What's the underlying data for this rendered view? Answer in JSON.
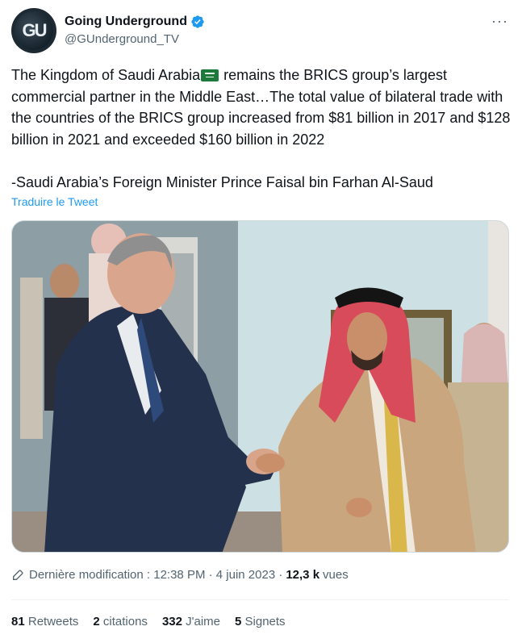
{
  "account": {
    "display_name": "Going Underground",
    "handle": "@GUnderground_TV",
    "avatar_letters": "GU",
    "verified": true,
    "more_label": "···"
  },
  "tweet": {
    "text_part1": "The Kingdom of Saudi Arabia",
    "flag_icon": "saudi-flag-emoji",
    "text_part2": " remains the BRICS group’s largest commercial partner in the Middle East…The total value of bilateral trade with the countries of the BRICS group increased from $81 billion in 2017 and $128 billion in 2021 and exceeded $160 billion in 2022",
    "signature": "-Saudi Arabia’s Foreign Minister Prince Faisal bin Farhan Al-Saud",
    "translate_label": "Traduire le Tweet"
  },
  "meta": {
    "edited_label": "Dernière modification : 12:38 PM · 4 juin 2023 · ",
    "views_count": "12,3 k",
    "views_label": " vues"
  },
  "stats": {
    "retweets_count": "81",
    "retweets_label": " Retweets",
    "quotes_count": "2",
    "quotes_label": " citations",
    "likes_count": "332",
    "likes_label": " J'aime",
    "bookmarks_count": "5",
    "bookmarks_label": " Signets"
  },
  "colors": {
    "accent": "#1d9bf0",
    "muted": "#536471",
    "text": "#0f1419"
  }
}
